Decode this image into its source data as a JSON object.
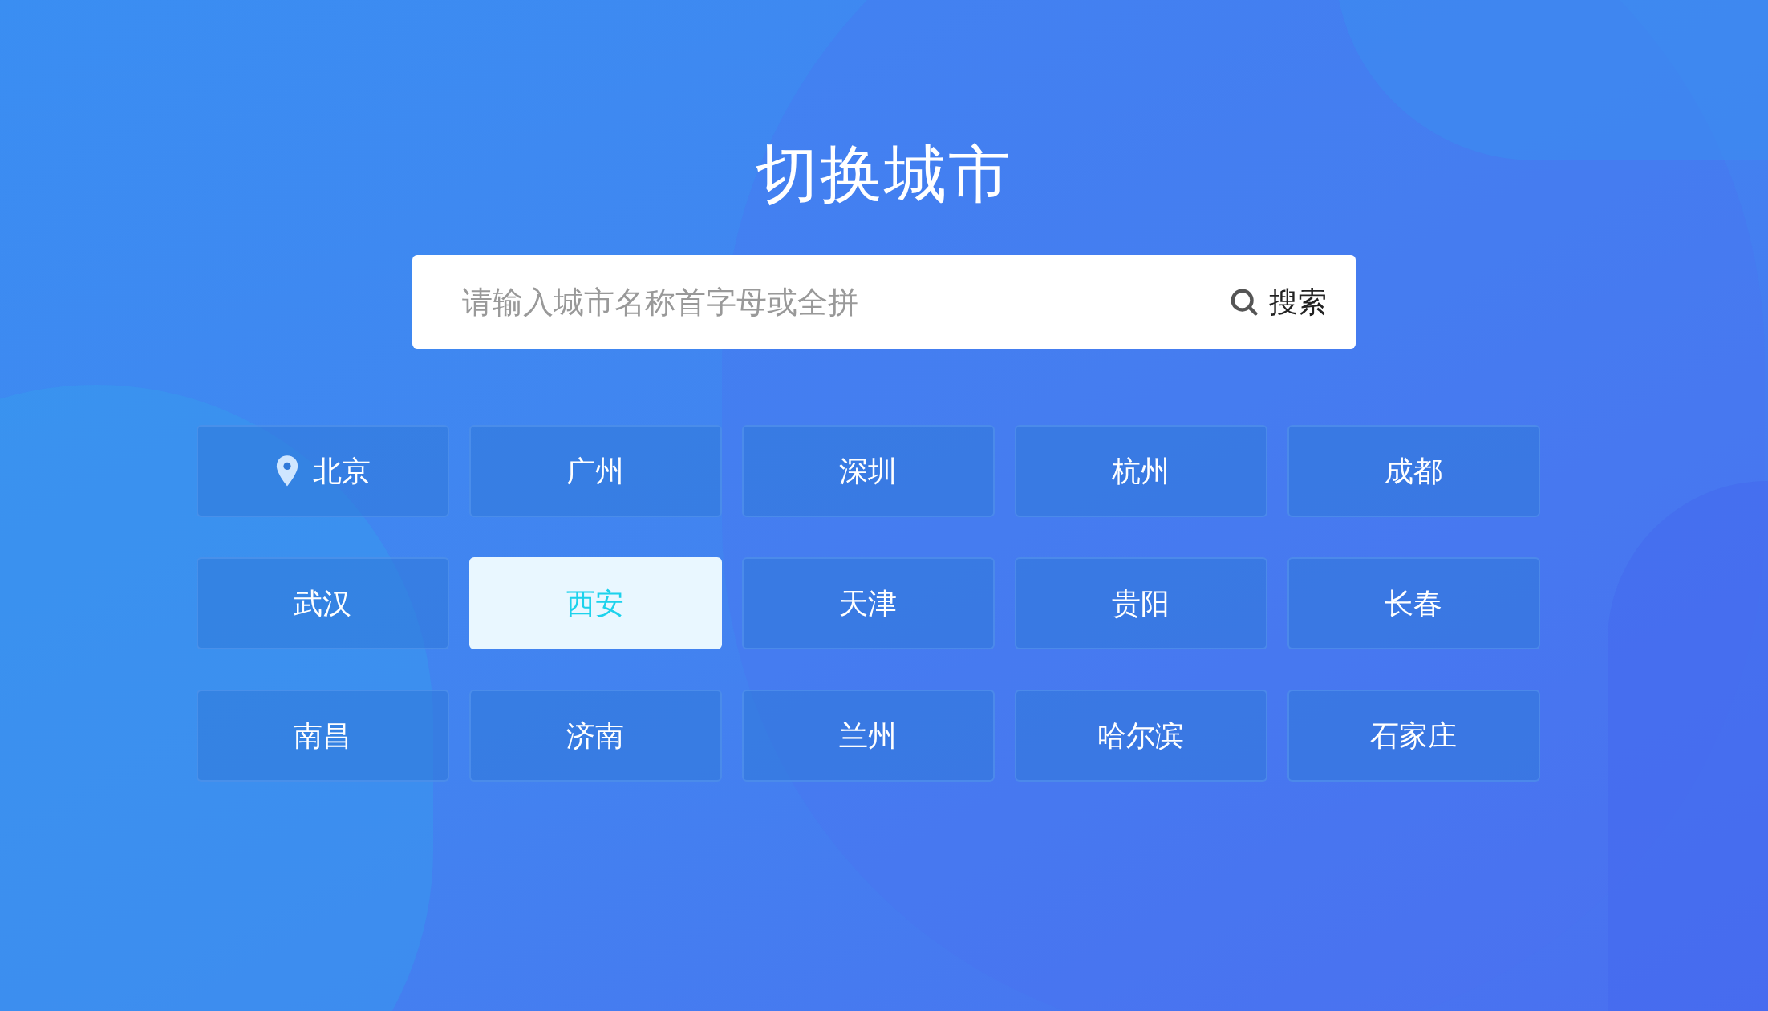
{
  "title": "切换城市",
  "search": {
    "placeholder": "请输入城市名称首字母或全拼",
    "button": "搜索"
  },
  "cities": [
    {
      "label": "北京",
      "selected": false,
      "located": true
    },
    {
      "label": "广州",
      "selected": false,
      "located": false
    },
    {
      "label": "深圳",
      "selected": false,
      "located": false
    },
    {
      "label": "杭州",
      "selected": false,
      "located": false
    },
    {
      "label": "成都",
      "selected": false,
      "located": false
    },
    {
      "label": "武汉",
      "selected": false,
      "located": false
    },
    {
      "label": "西安",
      "selected": true,
      "located": false
    },
    {
      "label": "天津",
      "selected": false,
      "located": false
    },
    {
      "label": "贵阳",
      "selected": false,
      "located": false
    },
    {
      "label": "长春",
      "selected": false,
      "located": false
    },
    {
      "label": "南昌",
      "selected": false,
      "located": false
    },
    {
      "label": "济南",
      "selected": false,
      "located": false
    },
    {
      "label": "兰州",
      "selected": false,
      "located": false
    },
    {
      "label": "哈尔滨",
      "selected": false,
      "located": false
    },
    {
      "label": "石家庄",
      "selected": false,
      "located": false
    }
  ]
}
